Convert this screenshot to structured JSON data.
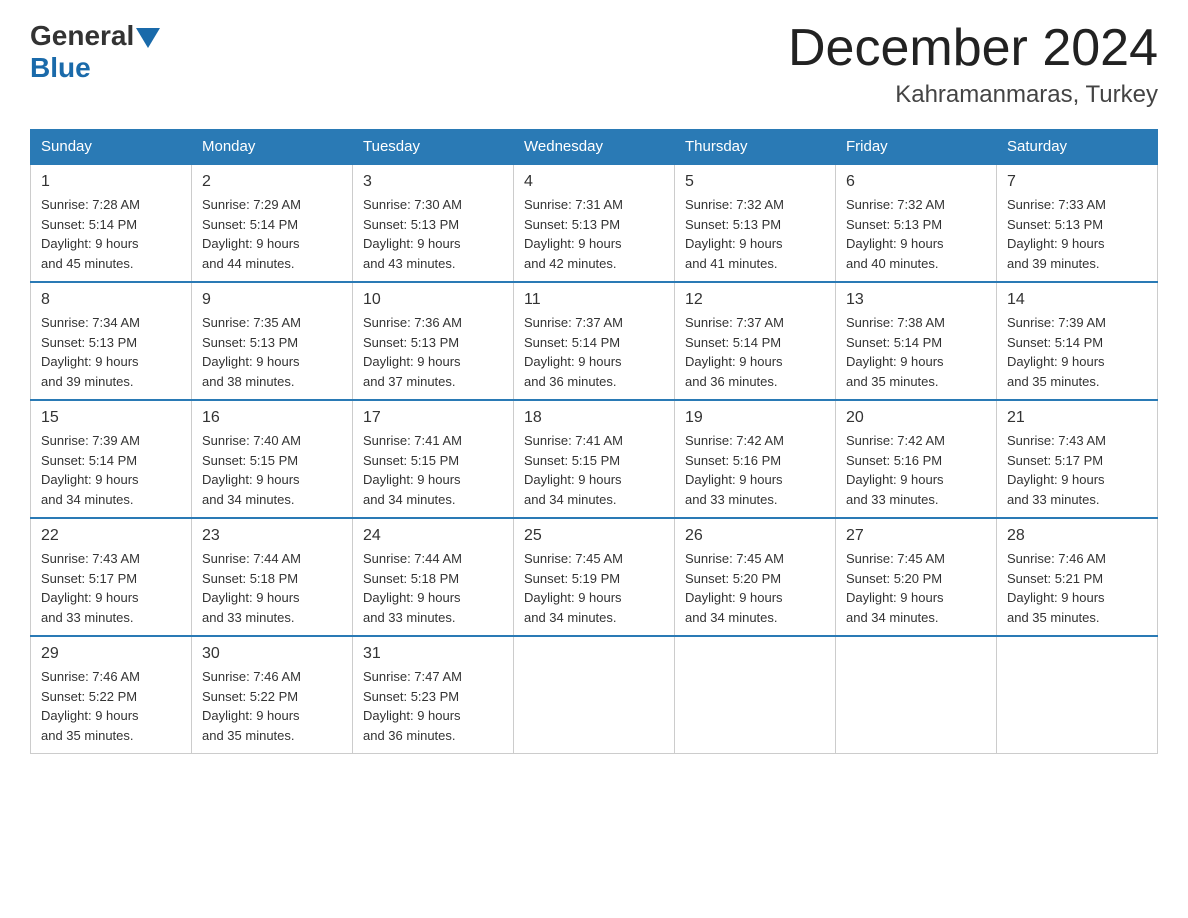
{
  "header": {
    "logo_general": "General",
    "logo_blue": "Blue",
    "title": "December 2024",
    "subtitle": "Kahramanmaras, Turkey"
  },
  "columns": [
    "Sunday",
    "Monday",
    "Tuesday",
    "Wednesday",
    "Thursday",
    "Friday",
    "Saturday"
  ],
  "weeks": [
    [
      {
        "day": "1",
        "sunrise": "7:28 AM",
        "sunset": "5:14 PM",
        "daylight": "9 hours and 45 minutes."
      },
      {
        "day": "2",
        "sunrise": "7:29 AM",
        "sunset": "5:14 PM",
        "daylight": "9 hours and 44 minutes."
      },
      {
        "day": "3",
        "sunrise": "7:30 AM",
        "sunset": "5:13 PM",
        "daylight": "9 hours and 43 minutes."
      },
      {
        "day": "4",
        "sunrise": "7:31 AM",
        "sunset": "5:13 PM",
        "daylight": "9 hours and 42 minutes."
      },
      {
        "day": "5",
        "sunrise": "7:32 AM",
        "sunset": "5:13 PM",
        "daylight": "9 hours and 41 minutes."
      },
      {
        "day": "6",
        "sunrise": "7:32 AM",
        "sunset": "5:13 PM",
        "daylight": "9 hours and 40 minutes."
      },
      {
        "day": "7",
        "sunrise": "7:33 AM",
        "sunset": "5:13 PM",
        "daylight": "9 hours and 39 minutes."
      }
    ],
    [
      {
        "day": "8",
        "sunrise": "7:34 AM",
        "sunset": "5:13 PM",
        "daylight": "9 hours and 39 minutes."
      },
      {
        "day": "9",
        "sunrise": "7:35 AM",
        "sunset": "5:13 PM",
        "daylight": "9 hours and 38 minutes."
      },
      {
        "day": "10",
        "sunrise": "7:36 AM",
        "sunset": "5:13 PM",
        "daylight": "9 hours and 37 minutes."
      },
      {
        "day": "11",
        "sunrise": "7:37 AM",
        "sunset": "5:14 PM",
        "daylight": "9 hours and 36 minutes."
      },
      {
        "day": "12",
        "sunrise": "7:37 AM",
        "sunset": "5:14 PM",
        "daylight": "9 hours and 36 minutes."
      },
      {
        "day": "13",
        "sunrise": "7:38 AM",
        "sunset": "5:14 PM",
        "daylight": "9 hours and 35 minutes."
      },
      {
        "day": "14",
        "sunrise": "7:39 AM",
        "sunset": "5:14 PM",
        "daylight": "9 hours and 35 minutes."
      }
    ],
    [
      {
        "day": "15",
        "sunrise": "7:39 AM",
        "sunset": "5:14 PM",
        "daylight": "9 hours and 34 minutes."
      },
      {
        "day": "16",
        "sunrise": "7:40 AM",
        "sunset": "5:15 PM",
        "daylight": "9 hours and 34 minutes."
      },
      {
        "day": "17",
        "sunrise": "7:41 AM",
        "sunset": "5:15 PM",
        "daylight": "9 hours and 34 minutes."
      },
      {
        "day": "18",
        "sunrise": "7:41 AM",
        "sunset": "5:15 PM",
        "daylight": "9 hours and 34 minutes."
      },
      {
        "day": "19",
        "sunrise": "7:42 AM",
        "sunset": "5:16 PM",
        "daylight": "9 hours and 33 minutes."
      },
      {
        "day": "20",
        "sunrise": "7:42 AM",
        "sunset": "5:16 PM",
        "daylight": "9 hours and 33 minutes."
      },
      {
        "day": "21",
        "sunrise": "7:43 AM",
        "sunset": "5:17 PM",
        "daylight": "9 hours and 33 minutes."
      }
    ],
    [
      {
        "day": "22",
        "sunrise": "7:43 AM",
        "sunset": "5:17 PM",
        "daylight": "9 hours and 33 minutes."
      },
      {
        "day": "23",
        "sunrise": "7:44 AM",
        "sunset": "5:18 PM",
        "daylight": "9 hours and 33 minutes."
      },
      {
        "day": "24",
        "sunrise": "7:44 AM",
        "sunset": "5:18 PM",
        "daylight": "9 hours and 33 minutes."
      },
      {
        "day": "25",
        "sunrise": "7:45 AM",
        "sunset": "5:19 PM",
        "daylight": "9 hours and 34 minutes."
      },
      {
        "day": "26",
        "sunrise": "7:45 AM",
        "sunset": "5:20 PM",
        "daylight": "9 hours and 34 minutes."
      },
      {
        "day": "27",
        "sunrise": "7:45 AM",
        "sunset": "5:20 PM",
        "daylight": "9 hours and 34 minutes."
      },
      {
        "day": "28",
        "sunrise": "7:46 AM",
        "sunset": "5:21 PM",
        "daylight": "9 hours and 35 minutes."
      }
    ],
    [
      {
        "day": "29",
        "sunrise": "7:46 AM",
        "sunset": "5:22 PM",
        "daylight": "9 hours and 35 minutes."
      },
      {
        "day": "30",
        "sunrise": "7:46 AM",
        "sunset": "5:22 PM",
        "daylight": "9 hours and 35 minutes."
      },
      {
        "day": "31",
        "sunrise": "7:47 AM",
        "sunset": "5:23 PM",
        "daylight": "9 hours and 36 minutes."
      },
      null,
      null,
      null,
      null
    ]
  ],
  "labels": {
    "sunrise": "Sunrise:",
    "sunset": "Sunset:",
    "daylight": "Daylight:"
  }
}
